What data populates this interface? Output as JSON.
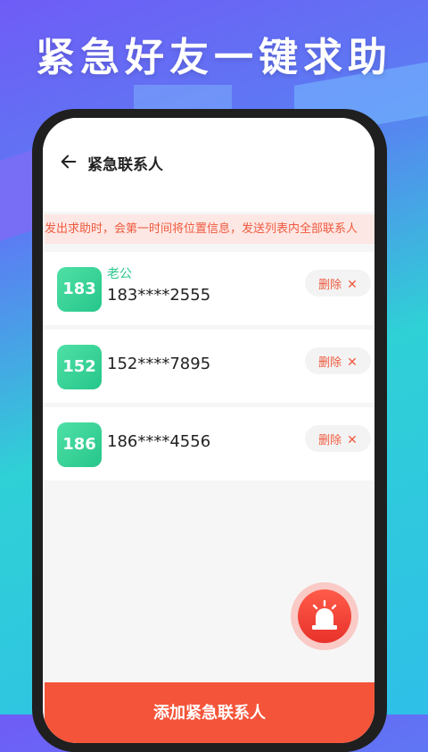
{
  "banner": {
    "headline": "紧急好友一键求助"
  },
  "header": {
    "title": "紧急联系人"
  },
  "notice": {
    "text": "发出求助时，会第一时间将位置信息，发送列表内全部联系人"
  },
  "contacts": [
    {
      "avatar": "183",
      "name": "老公",
      "phone": "183****2555",
      "delete_label": "删除"
    },
    {
      "avatar": "152",
      "name": "",
      "phone": "152****7895",
      "delete_label": "删除"
    },
    {
      "avatar": "186",
      "name": "",
      "phone": "186****4556",
      "delete_label": "删除"
    }
  ],
  "footer": {
    "add_label": "添加紧急联系人"
  },
  "icons": {
    "back": "arrow-left-icon",
    "delete": "close-icon",
    "sos": "alarm-siren-icon"
  },
  "colors": {
    "accent": "#F4553A",
    "avatar": "#2BC58B",
    "notice_bg": "#FDE7E4"
  }
}
